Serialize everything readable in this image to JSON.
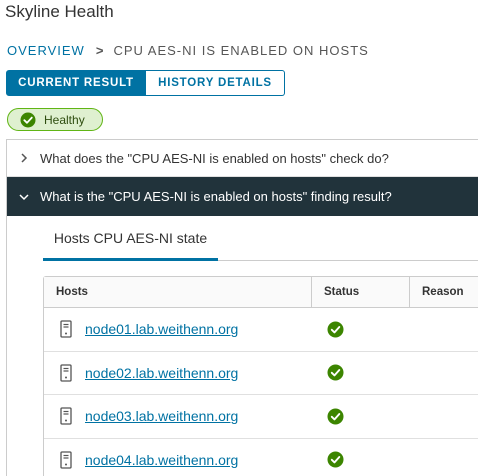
{
  "app": {
    "title": "Skyline Health"
  },
  "breadcrumb": {
    "root": "OVERVIEW",
    "separator": ">",
    "current": "CPU AES-NI IS ENABLED ON HOSTS"
  },
  "tabs": [
    {
      "label": "CURRENT RESULT",
      "active": true
    },
    {
      "label": "HISTORY DETAILS",
      "active": false
    }
  ],
  "status_badge": {
    "label": "Healthy",
    "icon": "check-circle-icon",
    "color": "#60b515"
  },
  "accordion": {
    "items": [
      {
        "label": "What does the \"CPU AES-NI is enabled on hosts\" check do?",
        "expanded": false,
        "icon": "chevron-right-icon"
      },
      {
        "label": "What is the \"CPU AES-NI is enabled on hosts\" finding result?",
        "expanded": true,
        "icon": "chevron-down-icon"
      }
    ]
  },
  "panel": {
    "tab_label": "Hosts CPU AES-NI state",
    "columns": [
      "Hosts",
      "Status",
      "Reason"
    ],
    "rows": [
      {
        "host": "node01.lab.weithenn.org",
        "status_icon": "ok-icon",
        "reason": ""
      },
      {
        "host": "node02.lab.weithenn.org",
        "status_icon": "ok-icon",
        "reason": ""
      },
      {
        "host": "node03.lab.weithenn.org",
        "status_icon": "ok-icon",
        "reason": ""
      },
      {
        "host": "node04.lab.weithenn.org",
        "status_icon": "ok-icon",
        "reason": ""
      }
    ]
  },
  "colors": {
    "accent": "#0072a3",
    "header_dark": "#21333b",
    "success": "#3c8500"
  }
}
